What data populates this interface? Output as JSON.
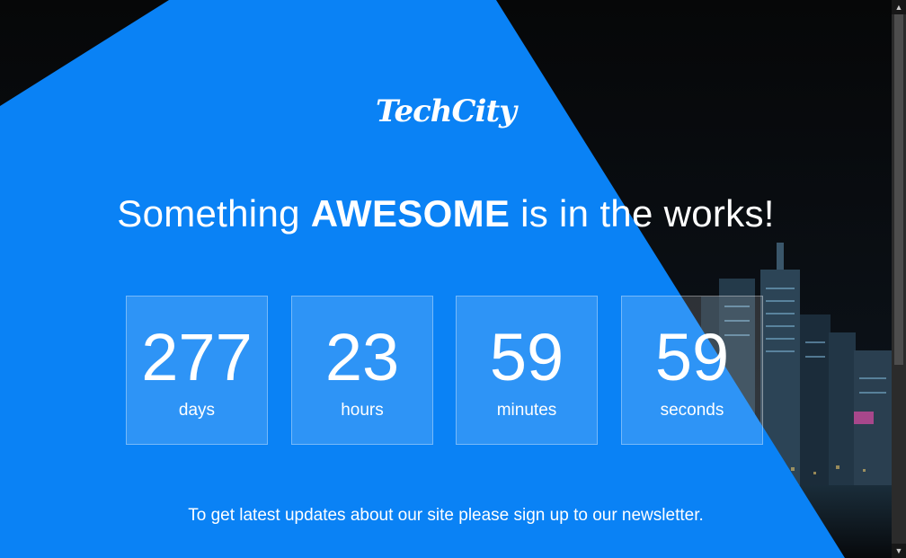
{
  "brand": {
    "logo_text": "TechCity"
  },
  "headline": {
    "prefix": "Something ",
    "emphasis": "AWESOME",
    "suffix": " is in the works!"
  },
  "countdown": [
    {
      "value": "277",
      "label": "days"
    },
    {
      "value": "23",
      "label": "hours"
    },
    {
      "value": "59",
      "label": "minutes"
    },
    {
      "value": "59",
      "label": "seconds"
    }
  ],
  "newsletter": {
    "text": "To get latest updates about our site please sign up to our newsletter."
  },
  "colors": {
    "accent_blue": "#0a82f5",
    "background_dark": "#050607",
    "text": "#ffffff"
  },
  "scrollbar": {
    "up_icon": "triangle-up-icon",
    "down_icon": "triangle-down-icon"
  }
}
